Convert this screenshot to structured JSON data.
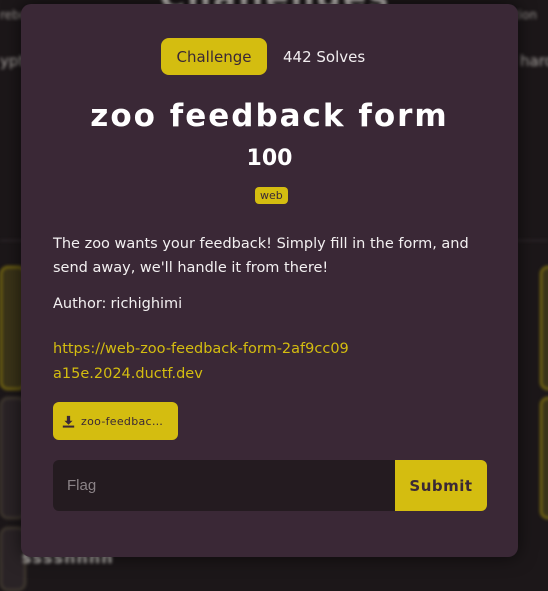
{
  "background": {
    "page_title": "Challenges",
    "top_categories": [
      "rebo",
      "cation"
    ],
    "categories": [
      "ypt",
      "hard"
    ],
    "card_text": "sssshhhh"
  },
  "modal": {
    "tabs": {
      "challenge_label": "Challenge",
      "solves_label": "442 Solves"
    },
    "title": "zoo feedback form",
    "points": "100",
    "tag": "web",
    "description": "The zoo wants your feedback! Simply fill in the form, and send away, we'll handle it from there!",
    "author_label": "Author:",
    "author": "richighimi",
    "link": "https://web-zoo-feedback-form-2af9cc09a15e.2024.ductf.dev",
    "file_label": "zoo-feedback-form.zip",
    "file_icon": "download-icon",
    "flag_placeholder": "Flag",
    "submit_label": "Submit"
  },
  "colors": {
    "accent": "#d4bd10",
    "modal_bg": "#3a2836",
    "input_bg": "#241b20"
  }
}
